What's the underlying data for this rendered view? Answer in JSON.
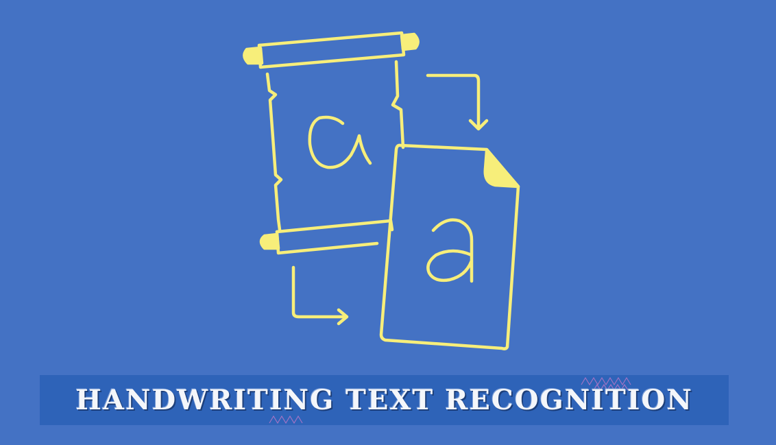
{
  "title": "HANDWRITING TEXT RECOGNITION",
  "colors": {
    "background": "#4472C4",
    "banner": "#2E63B8",
    "illustration_stroke": "#F7EE7A",
    "title_text": "#F4F6FA"
  },
  "illustration": {
    "scroll_glyph": "a",
    "document_glyph": "a",
    "icons": [
      "scroll-icon",
      "document-icon",
      "arrow-right-down-icon",
      "arrow-down-right-icon"
    ]
  }
}
